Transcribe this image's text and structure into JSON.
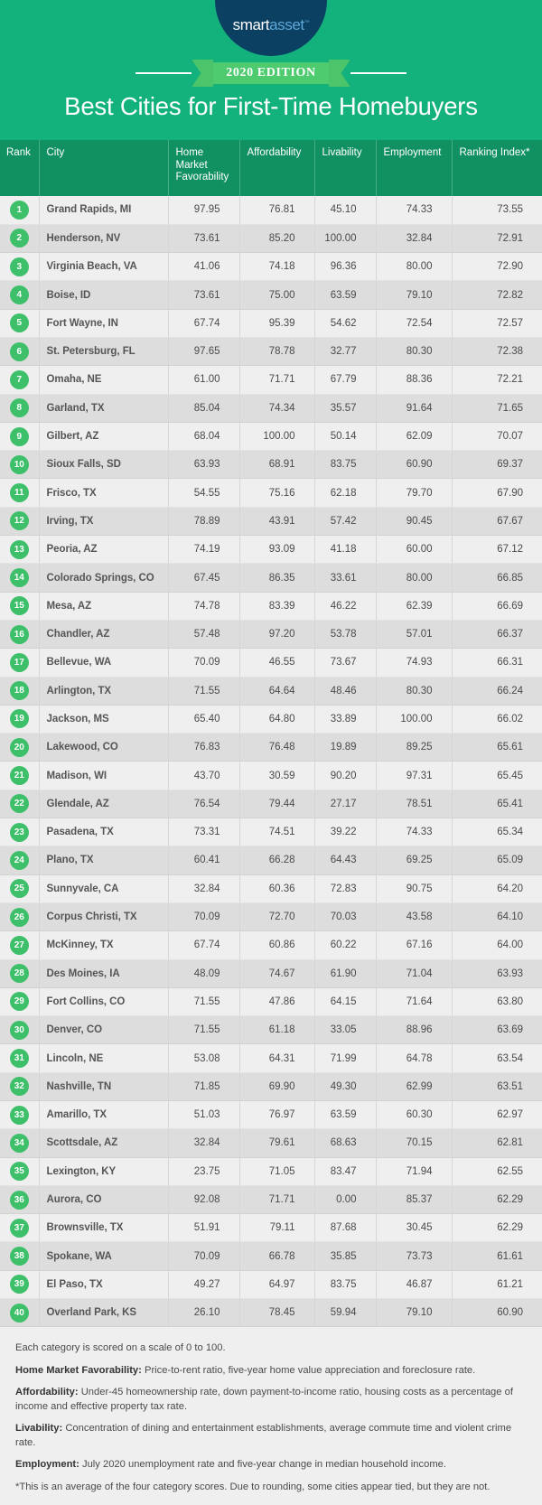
{
  "hero": {
    "logo": {
      "part_a": "smart",
      "part_b": "asset",
      "trademark": "™"
    },
    "edition_badge": "2020 EDITION",
    "title": "Best Cities for First-Time Homebuyers"
  },
  "colors": {
    "hero_green": "#13b17c",
    "header_green": "#119162",
    "badge_green": "#3ec06a",
    "ribbon_green": "#4ecb6e",
    "logo_navy": "#0b4063",
    "logo_blue": "#5ea8d8",
    "row_light": "#efeff0",
    "row_dark": "#dddddd"
  },
  "table": {
    "columns": [
      "Rank",
      "City",
      "Home Market Favorability",
      "Affordability",
      "Livability",
      "Employment",
      "Ranking Index*"
    ],
    "rows": [
      {
        "rank": "1",
        "city": "Grand Rapids, MI",
        "home_market": "97.95",
        "affordability": "76.81",
        "livability": "45.10",
        "employment": "74.33",
        "index": "73.55"
      },
      {
        "rank": "2",
        "city": "Henderson, NV",
        "home_market": "73.61",
        "affordability": "85.20",
        "livability": "100.00",
        "employment": "32.84",
        "index": "72.91"
      },
      {
        "rank": "3",
        "city": "Virginia Beach, VA",
        "home_market": "41.06",
        "affordability": "74.18",
        "livability": "96.36",
        "employment": "80.00",
        "index": "72.90"
      },
      {
        "rank": "4",
        "city": "Boise, ID",
        "home_market": "73.61",
        "affordability": "75.00",
        "livability": "63.59",
        "employment": "79.10",
        "index": "72.82"
      },
      {
        "rank": "5",
        "city": "Fort Wayne, IN",
        "home_market": "67.74",
        "affordability": "95.39",
        "livability": "54.62",
        "employment": "72.54",
        "index": "72.57"
      },
      {
        "rank": "6",
        "city": "St. Petersburg, FL",
        "home_market": "97.65",
        "affordability": "78.78",
        "livability": "32.77",
        "employment": "80.30",
        "index": "72.38"
      },
      {
        "rank": "7",
        "city": "Omaha, NE",
        "home_market": "61.00",
        "affordability": "71.71",
        "livability": "67.79",
        "employment": "88.36",
        "index": "72.21"
      },
      {
        "rank": "8",
        "city": "Garland, TX",
        "home_market": "85.04",
        "affordability": "74.34",
        "livability": "35.57",
        "employment": "91.64",
        "index": "71.65"
      },
      {
        "rank": "9",
        "city": "Gilbert, AZ",
        "home_market": "68.04",
        "affordability": "100.00",
        "livability": "50.14",
        "employment": "62.09",
        "index": "70.07"
      },
      {
        "rank": "10",
        "city": "Sioux Falls, SD",
        "home_market": "63.93",
        "affordability": "68.91",
        "livability": "83.75",
        "employment": "60.90",
        "index": "69.37"
      },
      {
        "rank": "11",
        "city": "Frisco, TX",
        "home_market": "54.55",
        "affordability": "75.16",
        "livability": "62.18",
        "employment": "79.70",
        "index": "67.90"
      },
      {
        "rank": "12",
        "city": "Irving, TX",
        "home_market": "78.89",
        "affordability": "43.91",
        "livability": "57.42",
        "employment": "90.45",
        "index": "67.67"
      },
      {
        "rank": "13",
        "city": "Peoria, AZ",
        "home_market": "74.19",
        "affordability": "93.09",
        "livability": "41.18",
        "employment": "60.00",
        "index": "67.12"
      },
      {
        "rank": "14",
        "city": "Colorado Springs, CO",
        "home_market": "67.45",
        "affordability": "86.35",
        "livability": "33.61",
        "employment": "80.00",
        "index": "66.85"
      },
      {
        "rank": "15",
        "city": "Mesa, AZ",
        "home_market": "74.78",
        "affordability": "83.39",
        "livability": "46.22",
        "employment": "62.39",
        "index": "66.69"
      },
      {
        "rank": "16",
        "city": "Chandler, AZ",
        "home_market": "57.48",
        "affordability": "97.20",
        "livability": "53.78",
        "employment": "57.01",
        "index": "66.37"
      },
      {
        "rank": "17",
        "city": "Bellevue, WA",
        "home_market": "70.09",
        "affordability": "46.55",
        "livability": "73.67",
        "employment": "74.93",
        "index": "66.31"
      },
      {
        "rank": "18",
        "city": "Arlington, TX",
        "home_market": "71.55",
        "affordability": "64.64",
        "livability": "48.46",
        "employment": "80.30",
        "index": "66.24"
      },
      {
        "rank": "19",
        "city": "Jackson, MS",
        "home_market": "65.40",
        "affordability": "64.80",
        "livability": "33.89",
        "employment": "100.00",
        "index": "66.02"
      },
      {
        "rank": "20",
        "city": "Lakewood, CO",
        "home_market": "76.83",
        "affordability": "76.48",
        "livability": "19.89",
        "employment": "89.25",
        "index": "65.61"
      },
      {
        "rank": "21",
        "city": "Madison, WI",
        "home_market": "43.70",
        "affordability": "30.59",
        "livability": "90.20",
        "employment": "97.31",
        "index": "65.45"
      },
      {
        "rank": "22",
        "city": "Glendale, AZ",
        "home_market": "76.54",
        "affordability": "79.44",
        "livability": "27.17",
        "employment": "78.51",
        "index": "65.41"
      },
      {
        "rank": "23",
        "city": "Pasadena, TX",
        "home_market": "73.31",
        "affordability": "74.51",
        "livability": "39.22",
        "employment": "74.33",
        "index": "65.34"
      },
      {
        "rank": "24",
        "city": "Plano, TX",
        "home_market": "60.41",
        "affordability": "66.28",
        "livability": "64.43",
        "employment": "69.25",
        "index": "65.09"
      },
      {
        "rank": "25",
        "city": "Sunnyvale, CA",
        "home_market": "32.84",
        "affordability": "60.36",
        "livability": "72.83",
        "employment": "90.75",
        "index": "64.20"
      },
      {
        "rank": "26",
        "city": "Corpus Christi, TX",
        "home_market": "70.09",
        "affordability": "72.70",
        "livability": "70.03",
        "employment": "43.58",
        "index": "64.10"
      },
      {
        "rank": "27",
        "city": "McKinney, TX",
        "home_market": "67.74",
        "affordability": "60.86",
        "livability": "60.22",
        "employment": "67.16",
        "index": "64.00"
      },
      {
        "rank": "28",
        "city": "Des Moines, IA",
        "home_market": "48.09",
        "affordability": "74.67",
        "livability": "61.90",
        "employment": "71.04",
        "index": "63.93"
      },
      {
        "rank": "29",
        "city": "Fort Collins, CO",
        "home_market": "71.55",
        "affordability": "47.86",
        "livability": "64.15",
        "employment": "71.64",
        "index": "63.80"
      },
      {
        "rank": "30",
        "city": "Denver, CO",
        "home_market": "71.55",
        "affordability": "61.18",
        "livability": "33.05",
        "employment": "88.96",
        "index": "63.69"
      },
      {
        "rank": "31",
        "city": "Lincoln, NE",
        "home_market": "53.08",
        "affordability": "64.31",
        "livability": "71.99",
        "employment": "64.78",
        "index": "63.54"
      },
      {
        "rank": "32",
        "city": "Nashville, TN",
        "home_market": "71.85",
        "affordability": "69.90",
        "livability": "49.30",
        "employment": "62.99",
        "index": "63.51"
      },
      {
        "rank": "33",
        "city": "Amarillo, TX",
        "home_market": "51.03",
        "affordability": "76.97",
        "livability": "63.59",
        "employment": "60.30",
        "index": "62.97"
      },
      {
        "rank": "34",
        "city": "Scottsdale, AZ",
        "home_market": "32.84",
        "affordability": "79.61",
        "livability": "68.63",
        "employment": "70.15",
        "index": "62.81"
      },
      {
        "rank": "35",
        "city": "Lexington, KY",
        "home_market": "23.75",
        "affordability": "71.05",
        "livability": "83.47",
        "employment": "71.94",
        "index": "62.55"
      },
      {
        "rank": "36",
        "city": "Aurora, CO",
        "home_market": "92.08",
        "affordability": "71.71",
        "livability": "0.00",
        "employment": "85.37",
        "index": "62.29"
      },
      {
        "rank": "37",
        "city": "Brownsville, TX",
        "home_market": "51.91",
        "affordability": "79.11",
        "livability": "87.68",
        "employment": "30.45",
        "index": "62.29"
      },
      {
        "rank": "38",
        "city": "Spokane, WA",
        "home_market": "70.09",
        "affordability": "66.78",
        "livability": "35.85",
        "employment": "73.73",
        "index": "61.61"
      },
      {
        "rank": "39",
        "city": "El Paso, TX",
        "home_market": "49.27",
        "affordability": "64.97",
        "livability": "83.75",
        "employment": "46.87",
        "index": "61.21"
      },
      {
        "rank": "40",
        "city": "Overland Park, KS",
        "home_market": "26.10",
        "affordability": "78.45",
        "livability": "59.94",
        "employment": "79.10",
        "index": "60.90"
      }
    ]
  },
  "notes": [
    {
      "label": "",
      "text": "Each category is scored on a scale of 0 to 100."
    },
    {
      "label": "Home Market Favorability:",
      "text": " Price-to-rent ratio, five-year home value appreciation and foreclosure rate."
    },
    {
      "label": "Affordability:",
      "text": " Under-45 homeownership rate, down payment-to-income ratio, housing costs as a percentage of income and effective property tax rate."
    },
    {
      "label": "Livability:",
      "text": " Concentration of dining and entertainment establishments, average commute time and violent crime rate."
    },
    {
      "label": "Employment:",
      "text": " July 2020 unemployment rate and five-year change in median household income."
    },
    {
      "label": "",
      "text": "*This is an average of the four category scores. Due to rounding, some cities appear tied, but they are not."
    }
  ]
}
